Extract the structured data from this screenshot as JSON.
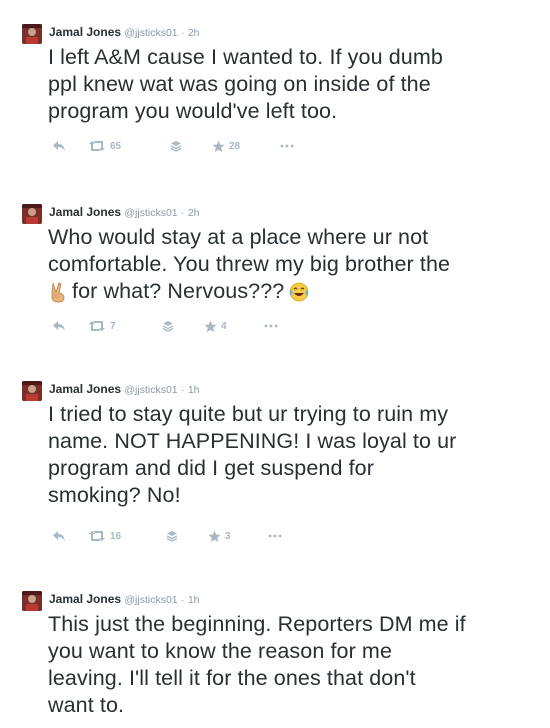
{
  "tweets": [
    {
      "name": "Jamal Jones",
      "handle": "@jjsticks01",
      "time": "2h",
      "lines": [
        "I left A&M cause I wanted to. If you dumb",
        "ppl knew wat was going on inside of the",
        "program you would've left too."
      ],
      "retweets": "65",
      "favorites": "28"
    },
    {
      "name": "Jamal Jones",
      "handle": "@jjsticks01",
      "time": "2h",
      "lines": [
        "Who would stay at a place where ur not",
        "comfortable. You threw my big brother the",
        "for what? Nervous???"
      ],
      "retweets": "7",
      "favorites": "4"
    },
    {
      "name": "Jamal Jones",
      "handle": "@jjsticks01",
      "time": "1h",
      "lines": [
        "I tried to stay quite but ur trying to ruin my",
        "name. NOT HAPPENING! I was loyal to ur",
        "program and did I get suspend for",
        "smoking? No!"
      ],
      "retweets": "16",
      "favorites": "3"
    },
    {
      "name": "Jamal Jones",
      "handle": "@jjsticks01",
      "time": "1h",
      "lines": [
        "This just the beginning. Reporters DM me if",
        "you want to know the reason for me",
        "leaving. I'll tell it for the ones that don't",
        "want to."
      ]
    }
  ],
  "separator": "·",
  "icons": {
    "reply": "reply-icon",
    "retweet": "retweet-icon",
    "buffer": "buffer-icon",
    "favorite": "star-icon",
    "more": "more-icon",
    "victory": "victory-hand-emoji",
    "laugh": "tears-of-joy-emoji"
  },
  "colors": {
    "text": "#292f33",
    "meta": "#8899a6",
    "action": "#aab8c2",
    "avatar": "#6b2a26"
  }
}
